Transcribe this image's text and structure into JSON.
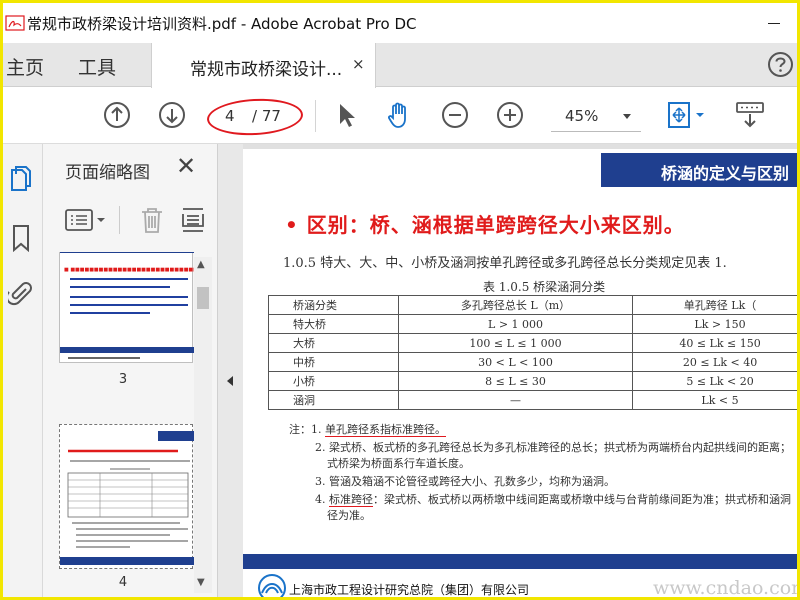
{
  "window": {
    "title": "常规市政桥梁设计培训资料.pdf - Adobe Acrobat Pro DC"
  },
  "tabs": {
    "home": "主页",
    "tools": "工具",
    "document": "常规市政桥梁设计...",
    "close_glyph": "×"
  },
  "toolbar": {
    "page_current": "4",
    "page_total": "/ 77",
    "zoom": "45%"
  },
  "panel": {
    "title": "页面缩略图",
    "close_glyph": "✕",
    "thumbnails": [
      {
        "page_label": "3"
      },
      {
        "page_label": "4"
      }
    ]
  },
  "document": {
    "header_banner": "桥涵的定义与区别",
    "red_title": "•  区别：桥、涵根据单跨跨径大小来区别。",
    "clause": "1.0.5   特大、大、中、小桥及涵洞按单孔跨径或多孔跨径总长分类规定见表 1.",
    "table_caption": "表 1.0.5   桥梁涵洞分类",
    "table": {
      "headers": [
        "桥涵分类",
        "多孔跨径总长 L（m）",
        "单孔跨径 Lk（"
      ],
      "rows": [
        [
          "特大桥",
          "L > 1 000",
          "Lk > 150"
        ],
        [
          "大桥",
          "100 ≤ L ≤ 1 000",
          "40 ≤ Lk ≤ 150"
        ],
        [
          "中桥",
          "30 < L < 100",
          "20 ≤ Lk < 40"
        ],
        [
          "小桥",
          "8 ≤ L ≤ 30",
          "5 ≤ Lk < 20"
        ],
        [
          "涵洞",
          "—",
          "Lk < 5"
        ]
      ]
    },
    "notes": {
      "n1_prefix": "注：1. ",
      "n1": "单孔跨径系指标准跨径。",
      "n2a": "2. 梁式桥、板式桥的多孔跨径总长为多孔标准跨径的总长；拱式桥为两端桥台内起拱线间的距离；",
      "n2b": "式桥梁为桥面系行车道长度。",
      "n3": "3. 管涵及箱涵不论管径或跨径大小、孔数多少，均称为涵洞。",
      "n4_prefix": "4. ",
      "n4_under": "标准跨径",
      "n4_rest": "：梁式桥、板式桥以两桥墩中线间距离或桥墩中线与台背前缘间距为准；拱式桥和涵洞",
      "n4b": "径为准。"
    },
    "footer_org": "上海市政工程设计研究总院（集团）有限公司",
    "watermark": "www.cndao.com"
  },
  "colors": {
    "accent_blue": "#1f3f8f",
    "red": "#e01b1b",
    "acrobat_blue": "#1a73c9",
    "frame_yellow": "#f2e600"
  }
}
